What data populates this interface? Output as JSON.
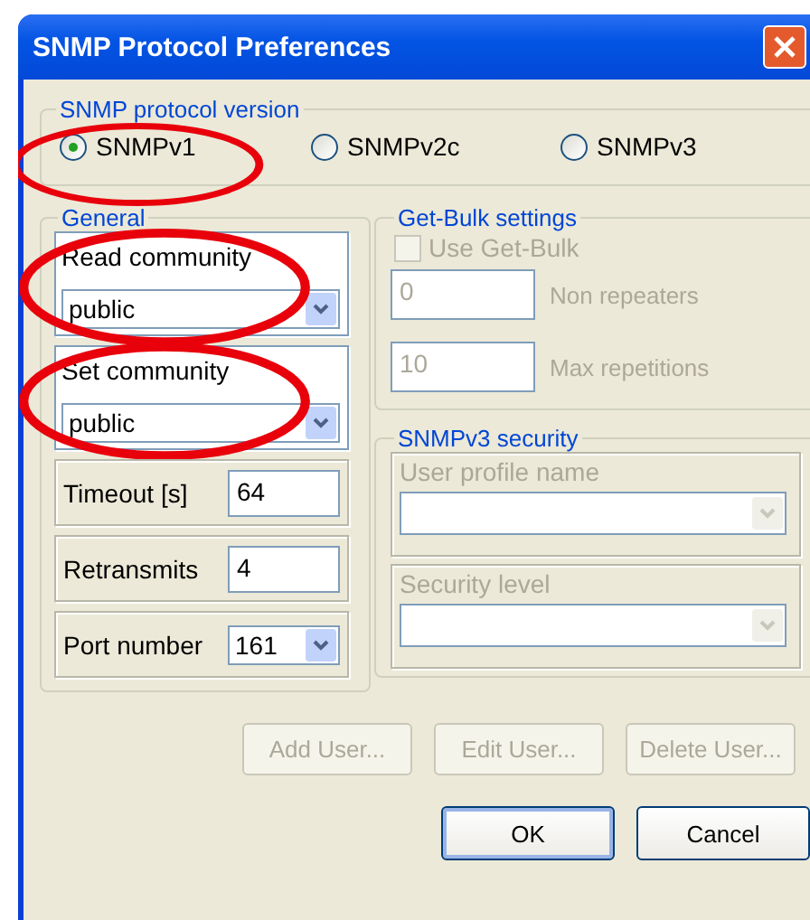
{
  "window": {
    "title": "SNMP Protocol Preferences"
  },
  "protocol_version": {
    "legend": "SNMP protocol version",
    "options": [
      {
        "label": "SNMPv1",
        "selected": true,
        "highlighted": true
      },
      {
        "label": "SNMPv2c",
        "selected": false,
        "highlighted": false
      },
      {
        "label": "SNMPv3",
        "selected": false,
        "highlighted": false
      }
    ]
  },
  "general": {
    "legend": "General",
    "fields": [
      {
        "kind": "combo",
        "label": "Read community",
        "value": "public",
        "highlighted": true
      },
      {
        "kind": "combo",
        "label": "Set community",
        "value": "public",
        "highlighted": true
      },
      {
        "kind": "text",
        "label": "Timeout [s]",
        "value": "64",
        "highlighted": false
      },
      {
        "kind": "text",
        "label": "Retransmits",
        "value": "4",
        "highlighted": false
      },
      {
        "kind": "inline-combo",
        "label": "Port number",
        "value": "161",
        "highlighted": false
      }
    ]
  },
  "get_bulk": {
    "legend": "Get-Bulk settings",
    "use_get_bulk": {
      "label": "Use Get-Bulk",
      "checked": false,
      "disabled": true
    },
    "fields": [
      {
        "value": "0",
        "label": "Non repeaters",
        "disabled": true
      },
      {
        "value": "10",
        "label": "Max repetitions",
        "disabled": true
      }
    ]
  },
  "snmpv3_security": {
    "legend": "SNMPv3 security",
    "fields": [
      {
        "label": "User profile name",
        "disabled": true
      },
      {
        "label": "Security level",
        "disabled": true
      }
    ]
  },
  "user_buttons": [
    {
      "label": "Add User...",
      "disabled": true
    },
    {
      "label": "Edit User...",
      "disabled": true
    },
    {
      "label": "Delete User...",
      "disabled": true
    }
  ],
  "dialog_buttons": [
    {
      "label": "OK",
      "default": true
    },
    {
      "label": "Cancel",
      "default": false
    }
  ]
}
